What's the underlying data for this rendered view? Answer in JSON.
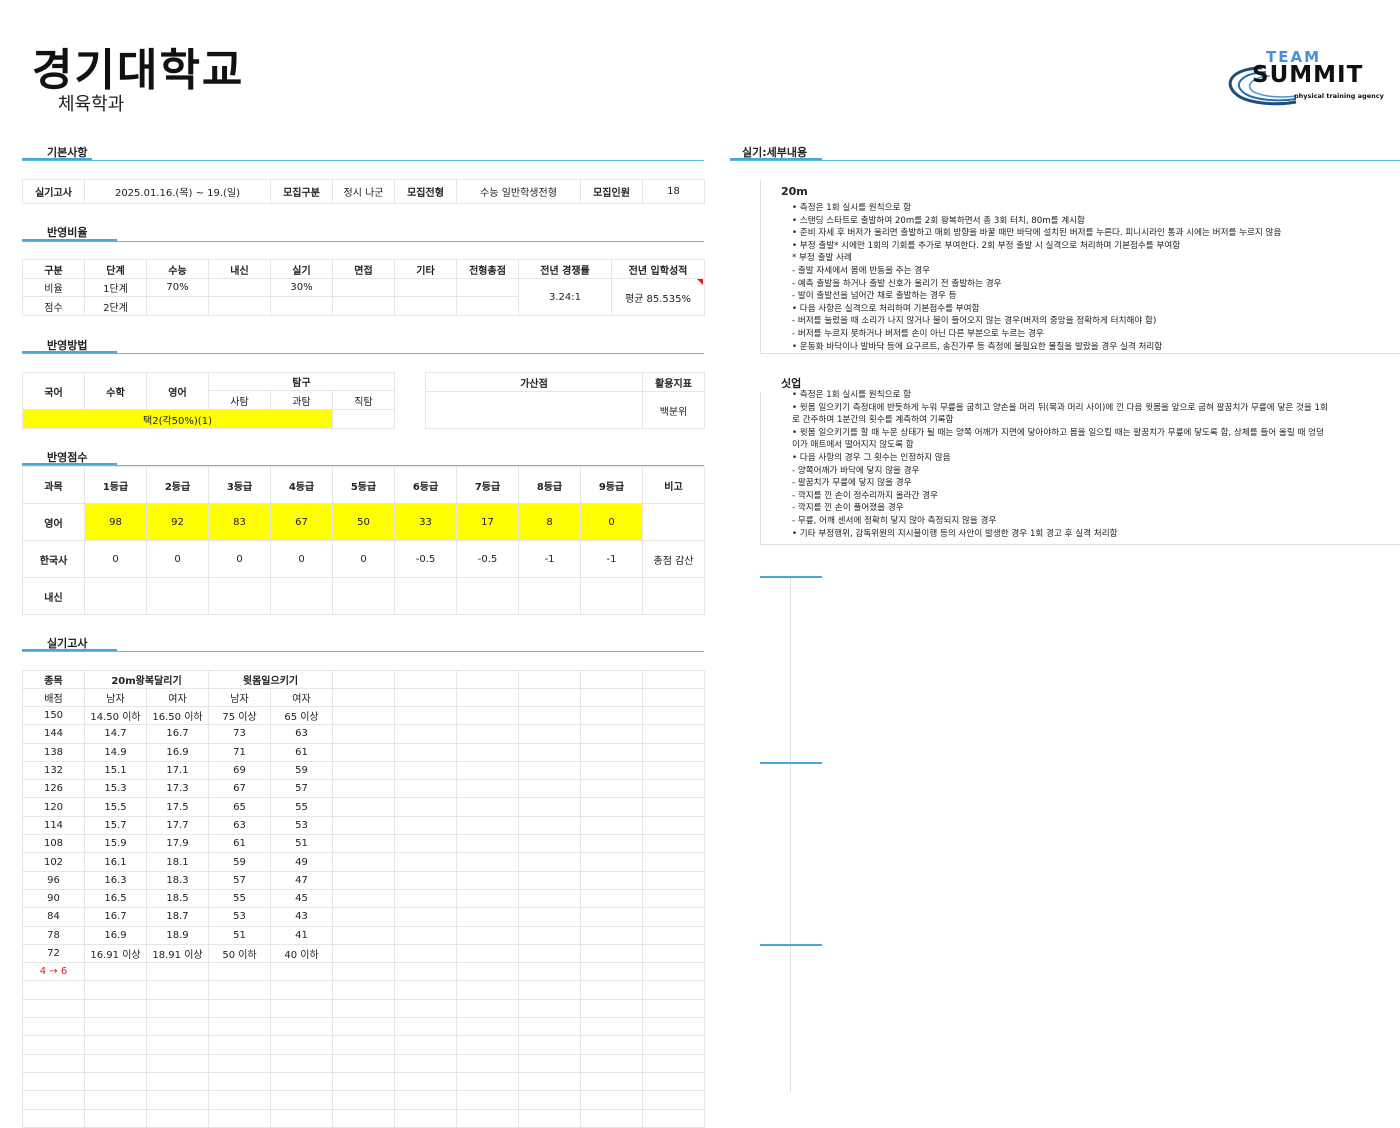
{
  "header": {
    "school": "경기대학교",
    "department": "체육학과"
  },
  "logo": {
    "line1": "TEAM",
    "line2": "SUMMIT",
    "line3": "physical training agency"
  },
  "sections": {
    "basic": "기본사항",
    "ratio": "반영비율",
    "method": "반영방법",
    "score": "반영점수",
    "practical": "실기고사",
    "detail": "실기:세부내용"
  },
  "basic": {
    "exam_label": "실기고사",
    "exam_value": "2025.01.16.(목) ~ 19.(일)",
    "recruit_type_label": "모집구분",
    "recruit_type_value": "정시 나군",
    "selection_label": "모집전형",
    "selection_value": "수능 일반학생전형",
    "quota_label": "모집인원",
    "quota_value": "18"
  },
  "ratio": {
    "headers": [
      "구분",
      "단계",
      "수능",
      "내신",
      "실기",
      "면접",
      "기타",
      "전형총점",
      "전년 경쟁률",
      "전년 입학성적"
    ],
    "row1": {
      "label": "비율",
      "stage": "1단계",
      "suneung": "70%",
      "practical": "30%"
    },
    "row2": {
      "label": "점수",
      "stage": "2단계"
    },
    "competition": "3.24:1",
    "admission_score": "평균 85.535%"
  },
  "method": {
    "korean": "국어",
    "math": "수학",
    "english": "영어",
    "inquiry": "탐구",
    "social": "사탐",
    "science": "과탐",
    "vocational": "직탐",
    "selection": "택2(각50%)(1)",
    "bonus": "가산점",
    "indicator": "활용지표",
    "indicator_value": "백분위"
  },
  "score": {
    "headers": [
      "과목",
      "1등급",
      "2등급",
      "3등급",
      "4등급",
      "5등급",
      "6등급",
      "7등급",
      "8등급",
      "9등급",
      "비고"
    ],
    "rows": [
      {
        "subject": "영어",
        "values": [
          "98",
          "92",
          "83",
          "67",
          "50",
          "33",
          "17",
          "8",
          "0"
        ],
        "note": ""
      },
      {
        "subject": "한국사",
        "values": [
          "0",
          "0",
          "0",
          "0",
          "0",
          "-0.5",
          "-0.5",
          "-1",
          "-1"
        ],
        "note": "총점 감산"
      },
      {
        "subject": "내신",
        "values": [
          "",
          "",
          "",
          "",
          "",
          "",
          "",
          "",
          ""
        ],
        "note": ""
      }
    ]
  },
  "practical": {
    "item_label": "종목",
    "event1": "20m왕복달리기",
    "event2": "윗몸일으키기",
    "points_label": "배점",
    "male": "남자",
    "female": "여자",
    "rows": [
      [
        "150",
        "14.50 이하",
        "16.50 이하",
        "75 이상",
        "65 이상"
      ],
      [
        "144",
        "14.7",
        "16.7",
        "73",
        "63"
      ],
      [
        "138",
        "14.9",
        "16.9",
        "71",
        "61"
      ],
      [
        "132",
        "15.1",
        "17.1",
        "69",
        "59"
      ],
      [
        "126",
        "15.3",
        "17.3",
        "67",
        "57"
      ],
      [
        "120",
        "15.5",
        "17.5",
        "65",
        "55"
      ],
      [
        "114",
        "15.7",
        "17.7",
        "63",
        "53"
      ],
      [
        "108",
        "15.9",
        "17.9",
        "61",
        "51"
      ],
      [
        "102",
        "16.1",
        "18.1",
        "59",
        "49"
      ],
      [
        "96",
        "16.3",
        "18.3",
        "57",
        "47"
      ],
      [
        "90",
        "16.5",
        "18.5",
        "55",
        "45"
      ],
      [
        "84",
        "16.7",
        "18.7",
        "53",
        "43"
      ],
      [
        "78",
        "16.9",
        "18.9",
        "51",
        "41"
      ],
      [
        "72",
        "16.91 이상",
        "18.91 이상",
        "50 이하",
        "40 이하"
      ]
    ],
    "footnote": "4 → 6"
  },
  "detail": {
    "run_title": "20m",
    "run_lines": [
      "• 측정은 1회 실시를 원칙으로 함",
      "• 스탠딩 스타트로 출발하여 20m를 2회 왕복하면서 총 3회 터치, 80m를 계시함",
      "• 준비 자세 후 버저가 울리면 출발하고 매회 방향을 바꿀 때만 바닥에 설치된 버저를 누른다. 피니시라인 통과 시에는 버저를 누르지 않음",
      "• 부정 출발* 시에만 1회의 기회를 추가로 부여한다. 2회 부정 출발 시 실격으로 처리하며 기본점수를 부여함",
      " * 부정 출발 사례",
      " - 출발 자세에서 몸에 반동을 주는 경우",
      " - 예측 출발을 하거나 출발 신호가 울리기 전 출발하는 경우",
      " - 발이 출발선을 넘어간 채로 출발하는 경우 등",
      "• 다음 사항은 실격으로 처리하며 기본점수를 부여함",
      " - 버저를 눌렀을 때 소리가 나지 않거나 불이 들어오지 않는 경우(버저의 중앙을 정확하게 터치해야 함)",
      " - 버저를 누르지 못하거나 버저를 손이 아닌 다른 부분으로 누르는 경우",
      "• 운동화 바닥이나 발바닥 등에 요구르트, 송진가루 등 측정에 불필요한 물질을 발랐을 경우 실격 처리함"
    ],
    "situp_title": "싯업",
    "situp_lines": [
      "• 측정은 1회 실시를 원칙으로 함",
      "• 윗몸 일으키기 측정대에 반듯하게 누워 무릎을 굽히고 양손을 머리 뒤(목과 머리 사이)에 낀 다음 윗몸을 앞으로 굽혀 팔꿈치가 무릎에 닿은 것을 1회",
      "로 간주하여 1분간의 횟수를 계측하여 기록함",
      "• 윗몸 일으키기를 할 때 누운 상태가 될 때는 양쪽 어깨가 지면에 닿아야하고 몸을 일으킬 때는 팔꿈치가 무릎에 닿도록 함, 상체를 들어 올릴 때 엉덩",
      "이가 매트에서 떨어지지 않도록 함",
      "• 다음 사항의 경우 그 횟수는 인정하지 않음",
      " - 양쪽어깨가 바닥에 닿지 않을 경우",
      " - 팔꿈치가 무릎에 닿지 않을 경우",
      " - 깍지를 낀 손이 정수리까지 올라간 경우",
      " - 깍지를 낀 손이 풀어졌을 경우",
      " - 무릎, 어깨 센서에 정확히 닿지 않아 측정되지 않을 경우",
      "• 기타 부정행위, 감독위원의 지시불이행 등의 사안이 발생한 경우 1회 경고 후 실격 처리함"
    ]
  }
}
